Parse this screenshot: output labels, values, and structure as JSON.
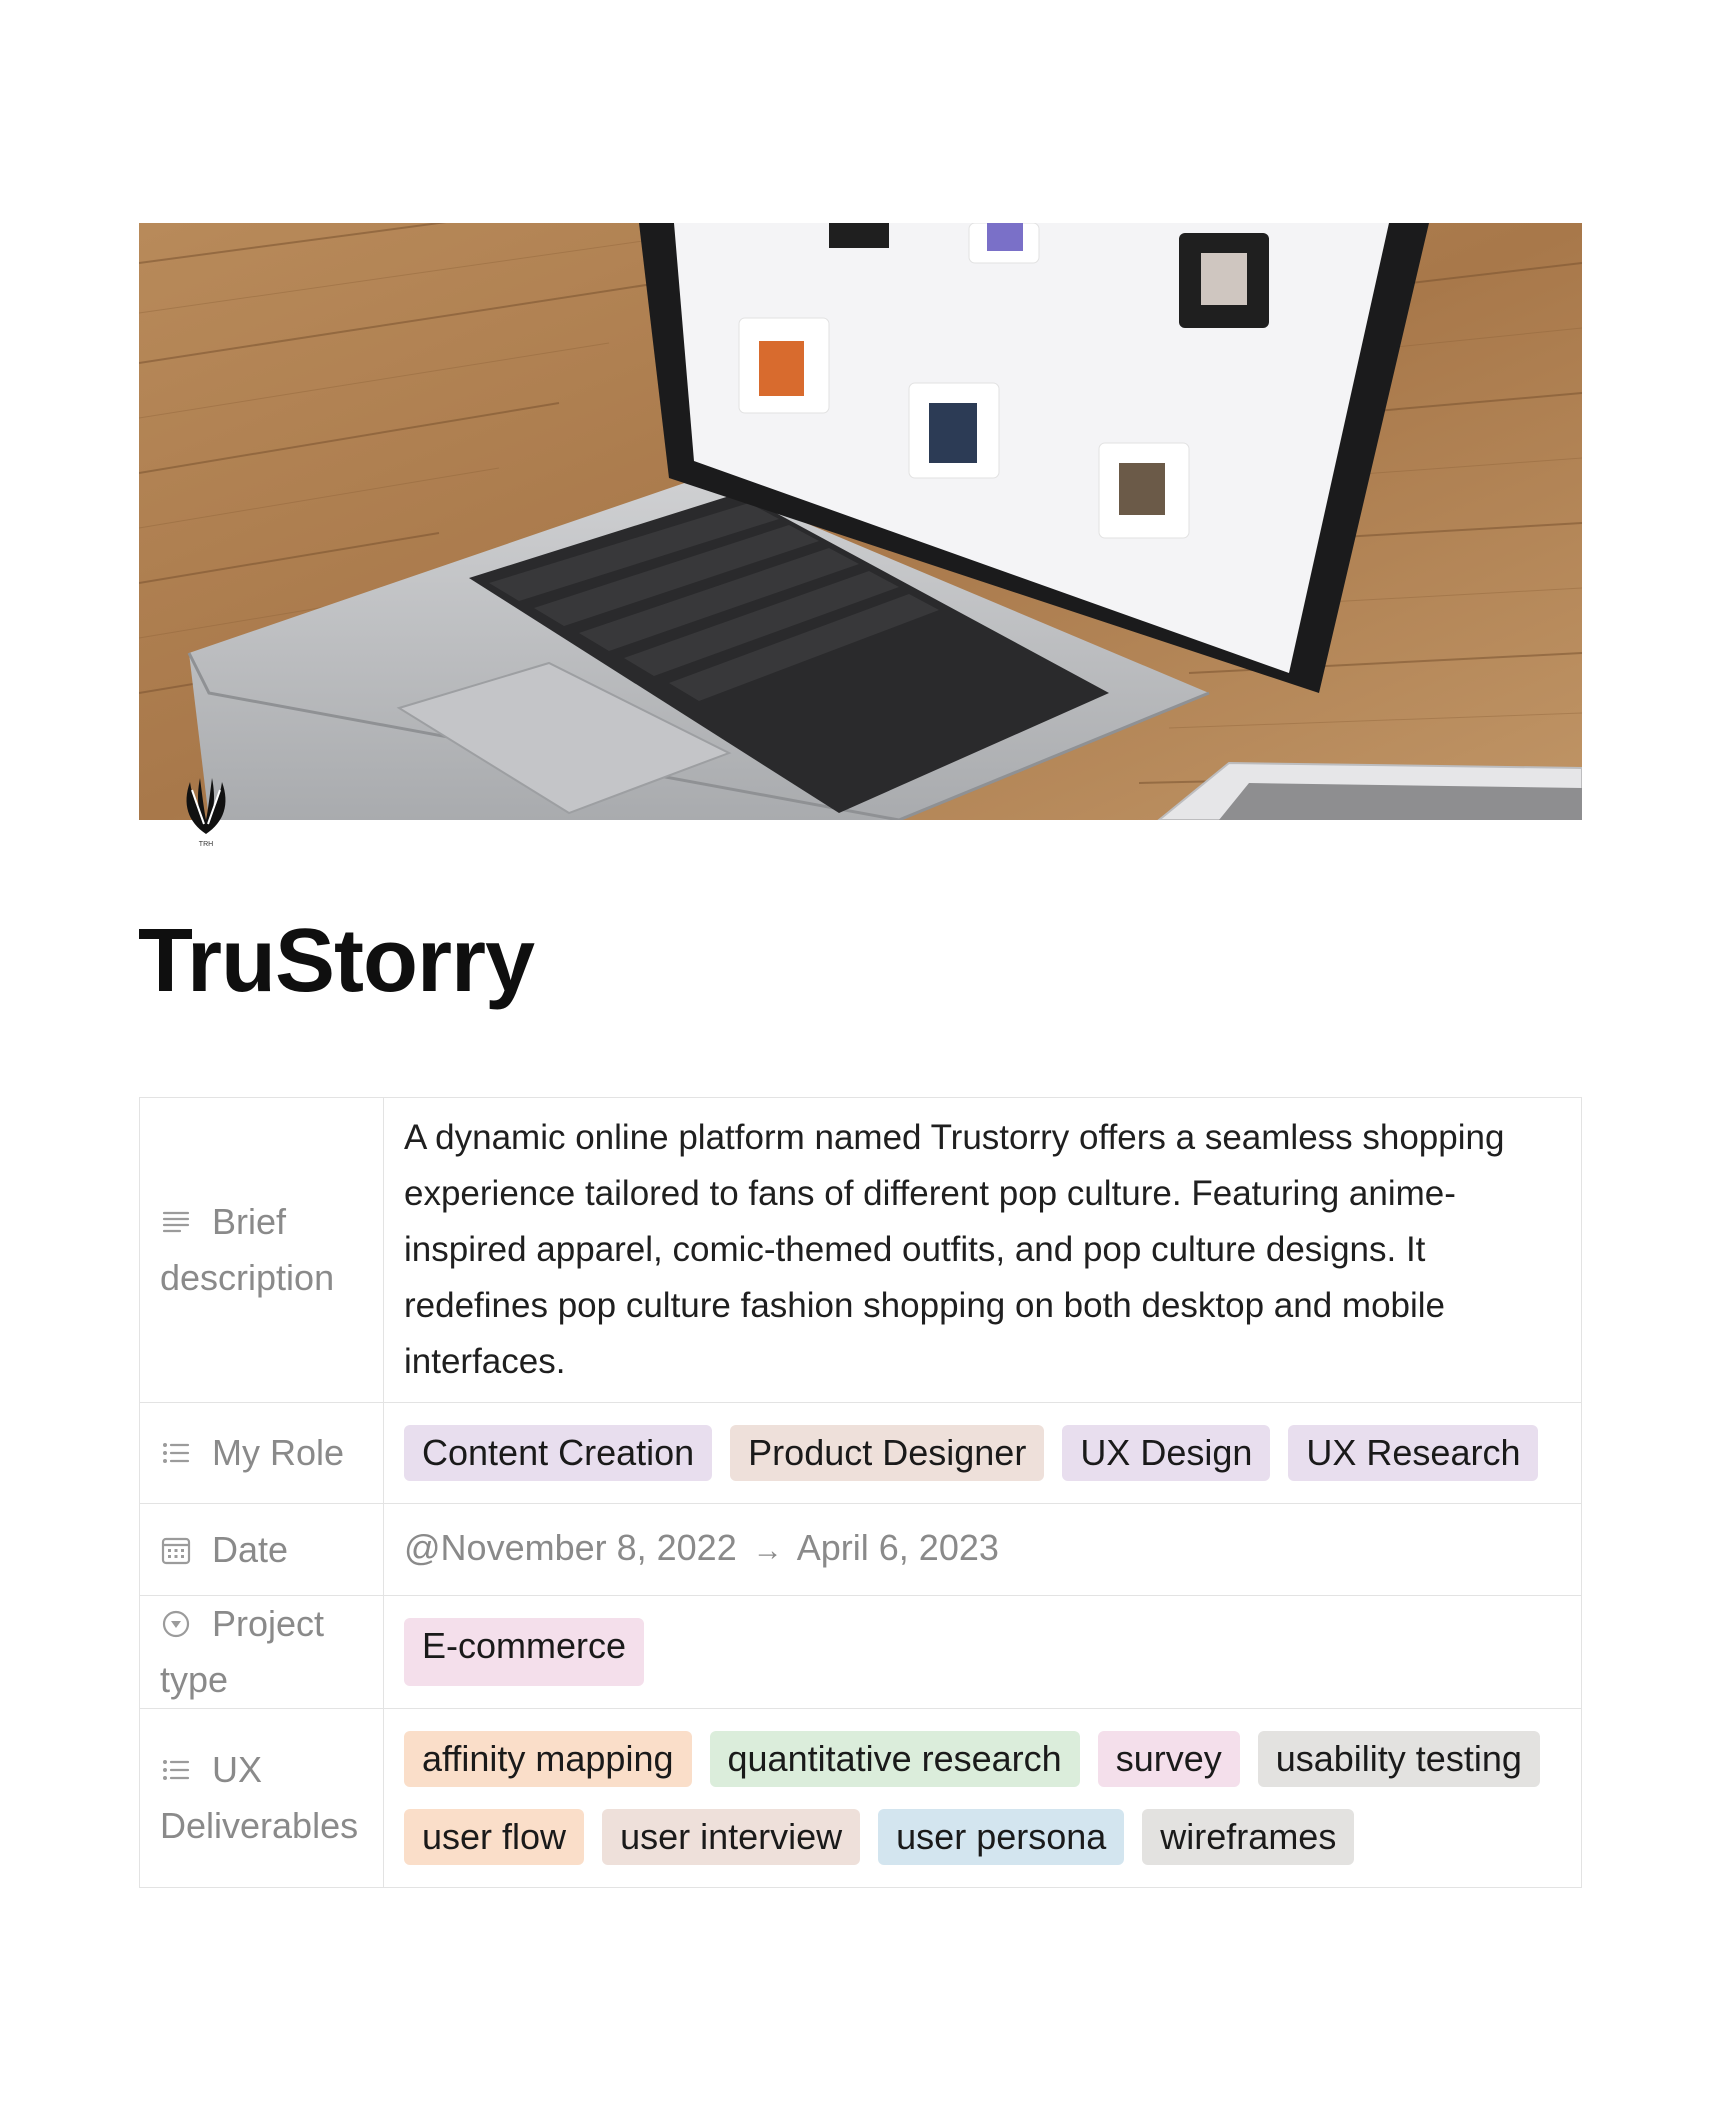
{
  "cover": {
    "image_description": "Laptop on wooden desk showing t-shirt e-commerce site, phone beside it"
  },
  "page_icon": {
    "name": "leaf-logo-icon",
    "caption": "TRH"
  },
  "title": "TruStorry",
  "properties": {
    "brief": {
      "label": "Brief description",
      "label_line1": "Brief",
      "label_line2": "description",
      "icon": "text-lines-icon",
      "value": "A dynamic online platform named Trustorry offers a seamless shopping experience tailored to fans of different pop culture. Featuring anime-inspired apparel, comic-themed outfits, and pop culture designs. It redefines pop culture fashion shopping on both desktop and mobile interfaces."
    },
    "role": {
      "label": "My Role",
      "icon": "multi-select-icon",
      "tags": [
        {
          "text": "Content Creation",
          "color": "#e8deee"
        },
        {
          "text": "Product Designer",
          "color": "#eee0da"
        },
        {
          "text": "UX Design",
          "color": "#e8deee"
        },
        {
          "text": "UX Research",
          "color": "#e8deee"
        }
      ]
    },
    "date": {
      "label": "Date",
      "icon": "calendar-icon",
      "start": "@November 8, 2022",
      "arrow": "→",
      "end": "April 6, 2023"
    },
    "project_type": {
      "label": "Project type",
      "label_line1": "Project",
      "label_line2": "type",
      "icon": "select-icon",
      "tags": [
        {
          "text": "E-commerce",
          "color": "#f4dfeb"
        }
      ]
    },
    "deliverables": {
      "label": "UX Deliverables",
      "label_line1": "UX",
      "label_line2": "Deliverables",
      "icon": "multi-select-icon",
      "tags": [
        {
          "text": "affinity mapping",
          "color": "#fadec9"
        },
        {
          "text": "quantitative research",
          "color": "#dbeddb"
        },
        {
          "text": "survey",
          "color": "#f4dfeb"
        },
        {
          "text": "usability testing",
          "color": "#e3e2e0"
        },
        {
          "text": "user flow",
          "color": "#fadec9"
        },
        {
          "text": "user interview",
          "color": "#eee0da"
        },
        {
          "text": "user persona",
          "color": "#d3e5ef"
        },
        {
          "text": "wireframes",
          "color": "#e3e2e0"
        }
      ]
    }
  }
}
